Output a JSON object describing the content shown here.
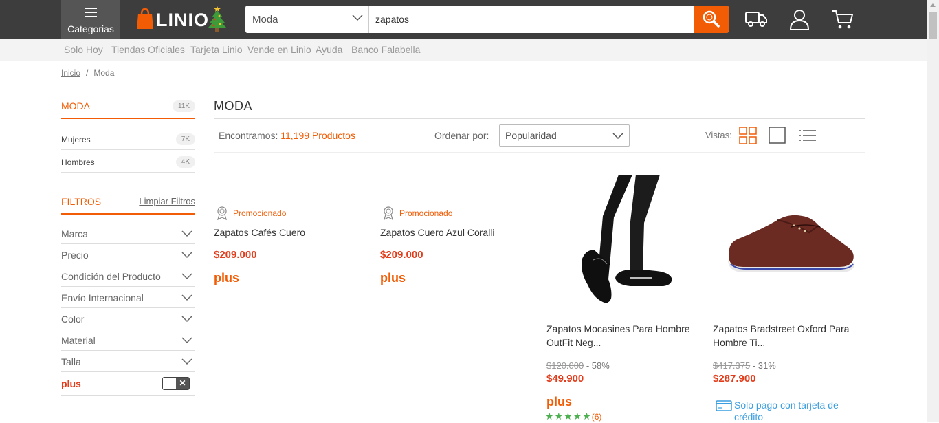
{
  "header": {
    "categories_label": "Categorias",
    "logo_text": "LINIO",
    "search_category": "Moda",
    "search_value": "zapatos"
  },
  "subnav": [
    "Solo Hoy",
    "Tiendas Oficiales",
    "Tarjeta Linio",
    "Vende en Linio",
    "Ayuda",
    "Banco Falabella"
  ],
  "breadcrumb": {
    "home": "Inicio",
    "separator": "/",
    "current": "Moda"
  },
  "sidebar": {
    "category_title": "MODA",
    "category_count": "11K",
    "subcategories": [
      {
        "label": "Mujeres",
        "count": "7K"
      },
      {
        "label": "Hombres",
        "count": "4K"
      }
    ],
    "filters_title": "FILTROS",
    "clear_filters": "Limpiar Filtros",
    "filters": [
      "Marca",
      "Precio",
      "Condición del Producto",
      "Envío Internacional",
      "Color",
      "Material",
      "Talla"
    ],
    "plus_label": "plus"
  },
  "main": {
    "title": "MODA",
    "found_prefix": "Encontramos:",
    "found_count": "11,199 Productos",
    "order_label": "Ordenar por:",
    "order_value": "Popularidad",
    "views_label": "Vistas:"
  },
  "products": [
    {
      "promo": "Promocionado",
      "name": "Zapatos Cafés Cuero",
      "price": "$209.000",
      "plus": "plus"
    },
    {
      "promo": "Promocionado",
      "name": "Zapatos Cuero Azul Coralli",
      "price": "$209.000",
      "plus": "plus"
    },
    {
      "name_line1": "Zapatos Mocasines Para Hombre",
      "name_line2": "OutFit Neg...",
      "old_price": "$120.000",
      "discount": "- 58%",
      "price": "$49.900",
      "plus": "plus",
      "stars": "★★★★★",
      "reviews": "(6)"
    },
    {
      "name_line1": "Zapatos Bradstreet Oxford Para",
      "name_line2": "Hombre Ti...",
      "old_price": "$417.375",
      "discount": "- 31%",
      "price": "$287.900",
      "credit_line1": "Solo pago con tarjeta de",
      "credit_line2": "crédito"
    }
  ],
  "colors": {
    "accent": "#f25c05",
    "price": "#e23c1a",
    "topbar": "#3d3d3d",
    "link_blue": "#3a9ee0"
  },
  "icons": [
    "menu-icon",
    "search-icon",
    "truck-icon",
    "user-icon",
    "cart-icon",
    "grid-view-icon",
    "single-view-icon",
    "list-view-icon",
    "award-icon",
    "credit-card-icon"
  ]
}
